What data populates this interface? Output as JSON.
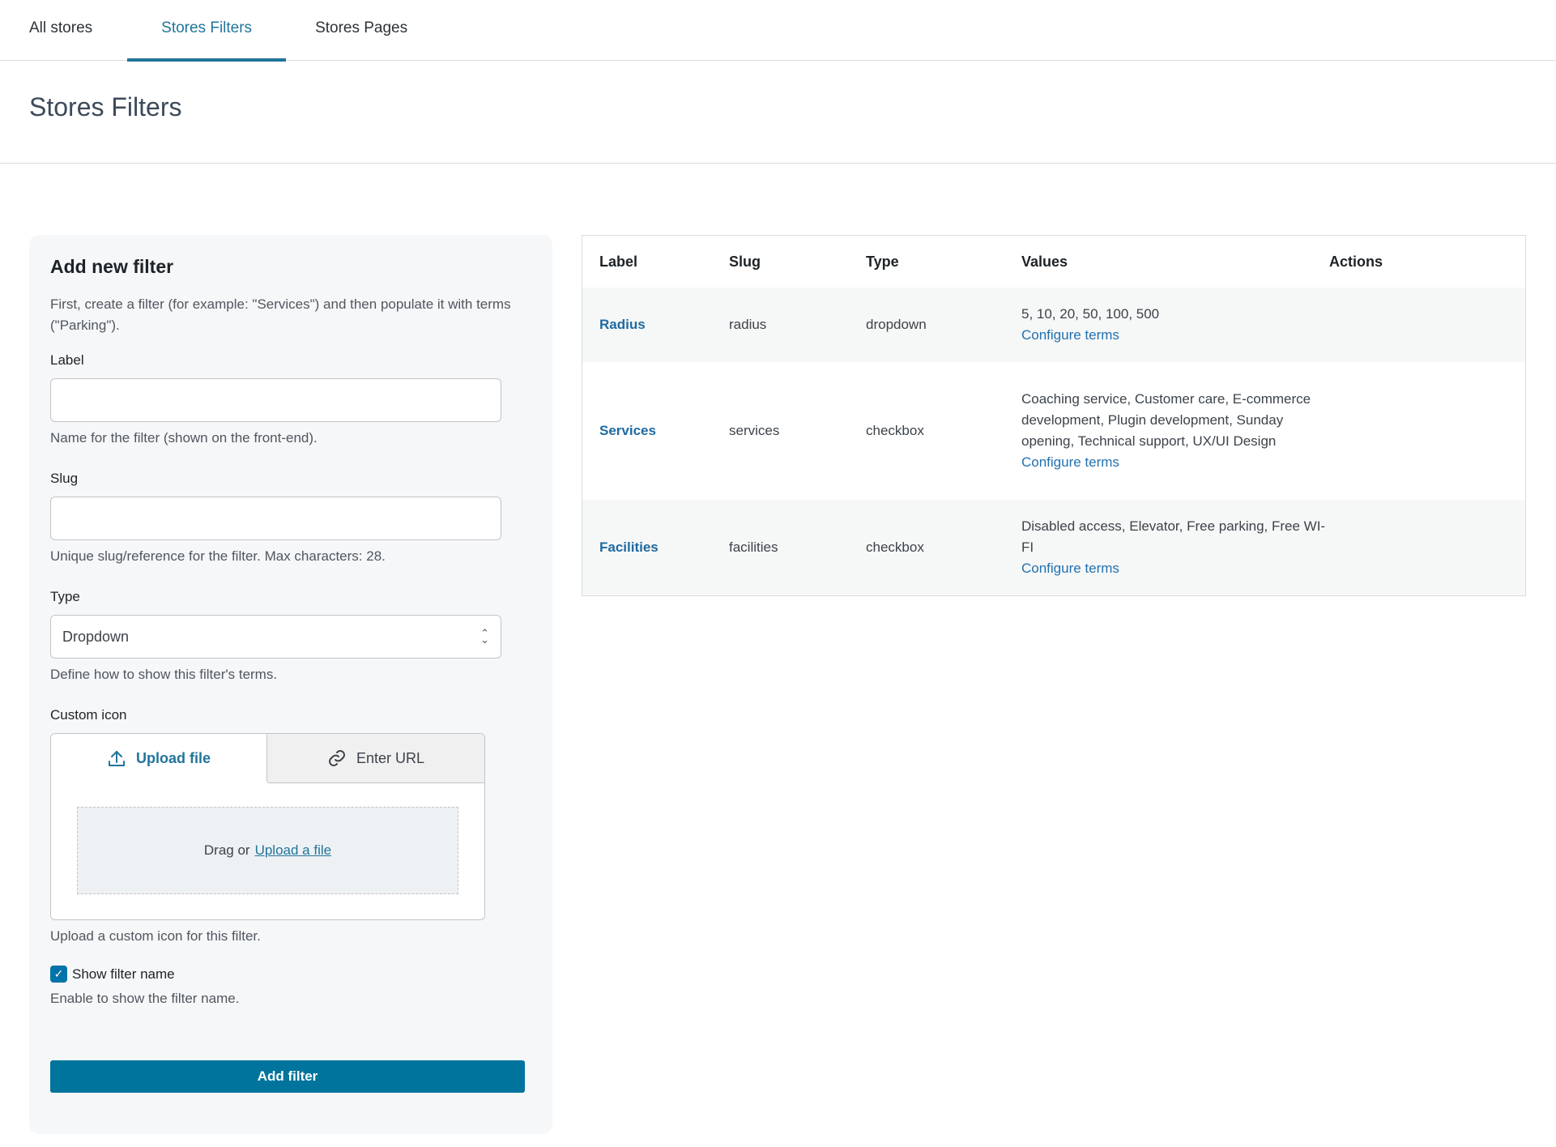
{
  "tabs": [
    {
      "label": "All stores"
    },
    {
      "label": "Stores Filters"
    },
    {
      "label": "Stores Pages"
    }
  ],
  "page_title": "Stores Filters",
  "form": {
    "title": "Add new filter",
    "description": "First, create a filter (for example: \"Services\") and then populate it with terms (\"Parking\").",
    "label_field": {
      "label": "Label",
      "value": "",
      "help": "Name for the filter (shown on the front-end)."
    },
    "slug_field": {
      "label": "Slug",
      "value": "",
      "help": "Unique slug/reference for the filter. Max characters: 28."
    },
    "type_field": {
      "label": "Type",
      "value": "Dropdown",
      "help": "Define how to show this filter's terms."
    },
    "icon_field": {
      "label": "Custom icon",
      "upload_tab": "Upload file",
      "url_tab": "Enter URL",
      "drag_text": "Drag or",
      "upload_link": "Upload a file",
      "help": "Upload a custom icon for this filter."
    },
    "show_name": {
      "label": "Show filter name",
      "checked": true,
      "help": "Enable to show the filter name."
    },
    "submit": "Add filter"
  },
  "table": {
    "headers": {
      "label": "Label",
      "slug": "Slug",
      "type": "Type",
      "values": "Values",
      "actions": "Actions"
    },
    "rows": [
      {
        "label": "Radius",
        "slug": "radius",
        "type": "dropdown",
        "values": "5, 10, 20, 50, 100, 500",
        "configure": "Configure terms"
      },
      {
        "label": "Services",
        "slug": "services",
        "type": "checkbox",
        "values": "Coaching service, Customer care, E-commerce development, Plugin development, Sunday opening, Technical support, UX/UI Design",
        "configure": "Configure terms"
      },
      {
        "label": "Facilities",
        "slug": "facilities",
        "type": "checkbox",
        "values": "Disabled access, Elevator, Free parking, Free WI-FI",
        "configure": "Configure terms"
      }
    ]
  },
  "colors": {
    "accent": "#21759b",
    "button": "#00749c"
  }
}
